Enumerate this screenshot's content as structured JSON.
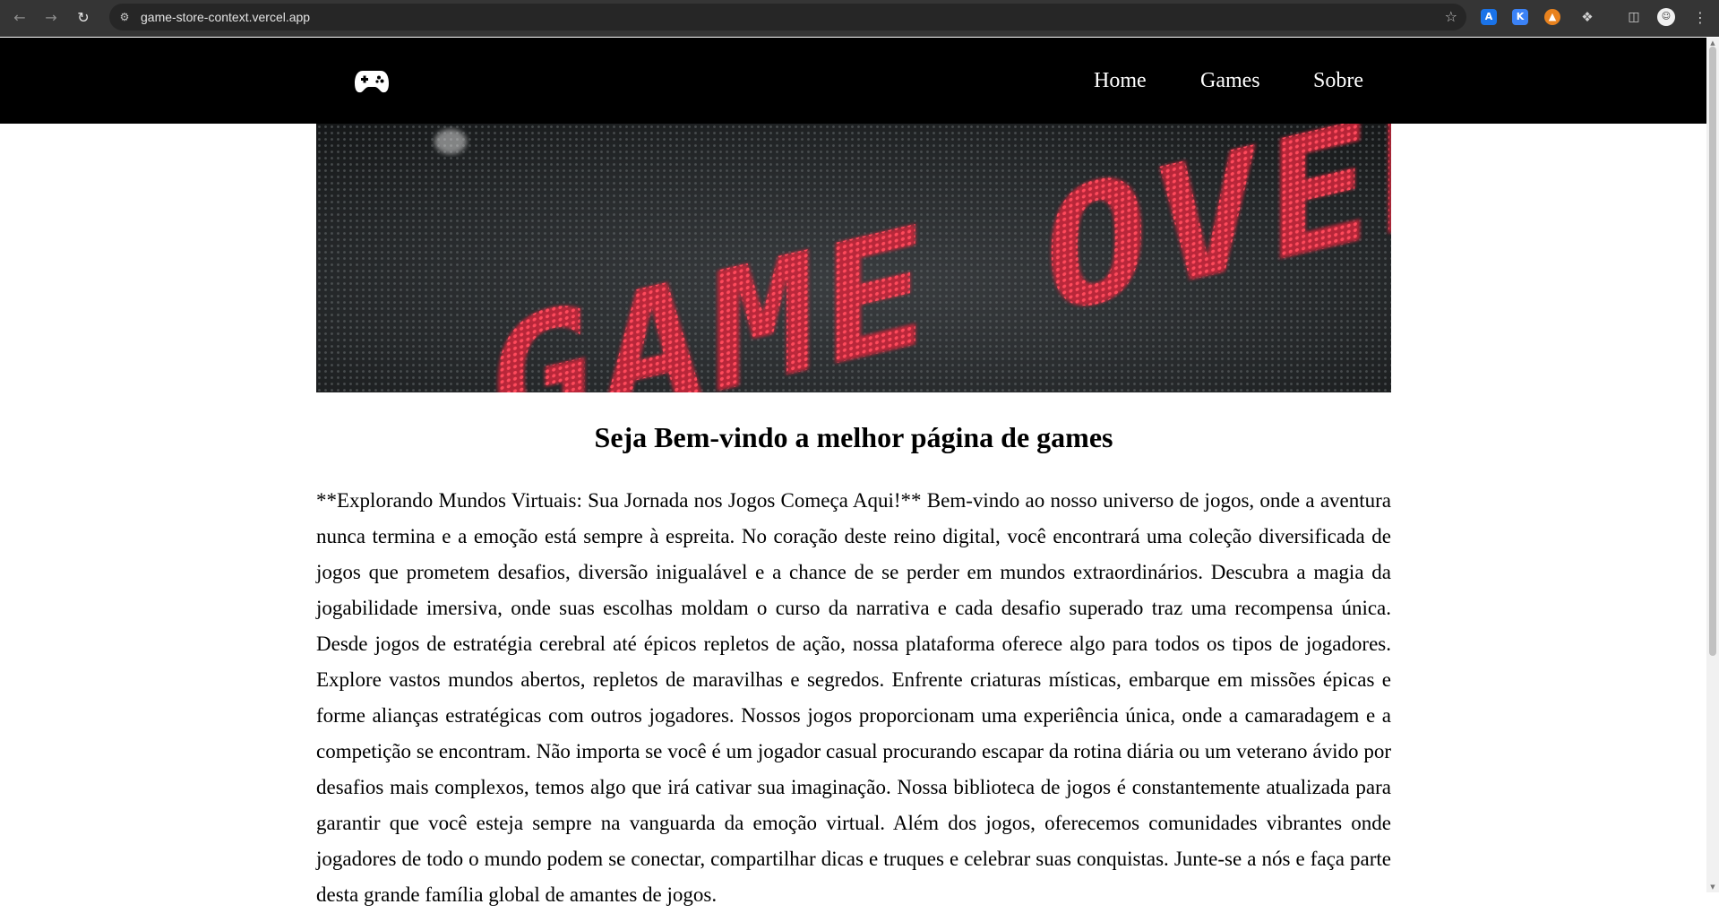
{
  "browser": {
    "url": "game-store-context.vercel.app",
    "icons": {
      "back": "arrow-left-icon",
      "forward": "arrow-right-icon",
      "reload": "reload-icon",
      "site_info": "tune-icon",
      "bookmark": "star-icon",
      "menu": "more-vertical-icon"
    },
    "extensions": [
      "shield-extension",
      "k-extension",
      "fox-extension",
      "puzzle-icon",
      "side-panel-icon"
    ]
  },
  "header": {
    "logo_icon": "gamepad-icon",
    "nav": [
      {
        "label": "Home"
      },
      {
        "label": "Games"
      },
      {
        "label": "Sobre"
      }
    ]
  },
  "hero": {
    "text": "GAME OVER",
    "colors": {
      "background": "#1f2224",
      "led": "#e8394d"
    }
  },
  "main": {
    "title": "Seja Bem-vindo a melhor página de games",
    "paragraph": "**Explorando Mundos Virtuais: Sua Jornada nos Jogos Começa Aqui!** Bem-vindo ao nosso universo de jogos, onde a aventura nunca termina e a emoção está sempre à espreita. No coração deste reino digital, você encontrará uma coleção diversificada de jogos que prometem desafios, diversão inigualável e a chance de se perder em mundos extraordinários. Descubra a magia da jogabilidade imersiva, onde suas escolhas moldam o curso da narrativa e cada desafio superado traz uma recompensa única. Desde jogos de estratégia cerebral até épicos repletos de ação, nossa plataforma oferece algo para todos os tipos de jogadores. Explore vastos mundos abertos, repletos de maravilhas e segredos. Enfrente criaturas místicas, embarque em missões épicas e forme alianças estratégicas com outros jogadores. Nossos jogos proporcionam uma experiência única, onde a camaradagem e a competição se encontram. Não importa se você é um jogador casual procurando escapar da rotina diária ou um veterano ávido por desafios mais complexos, temos algo que irá cativar sua imaginação. Nossa biblioteca de jogos é constantemente atualizada para garantir que você esteja sempre na vanguarda da emoção virtual. Além dos jogos, oferecemos comunidades vibrantes onde jogadores de todo o mundo podem se conectar, compartilhar dicas e truques e celebrar suas conquistas. Junte-se a nós e faça parte desta grande família global de amantes de jogos."
  }
}
